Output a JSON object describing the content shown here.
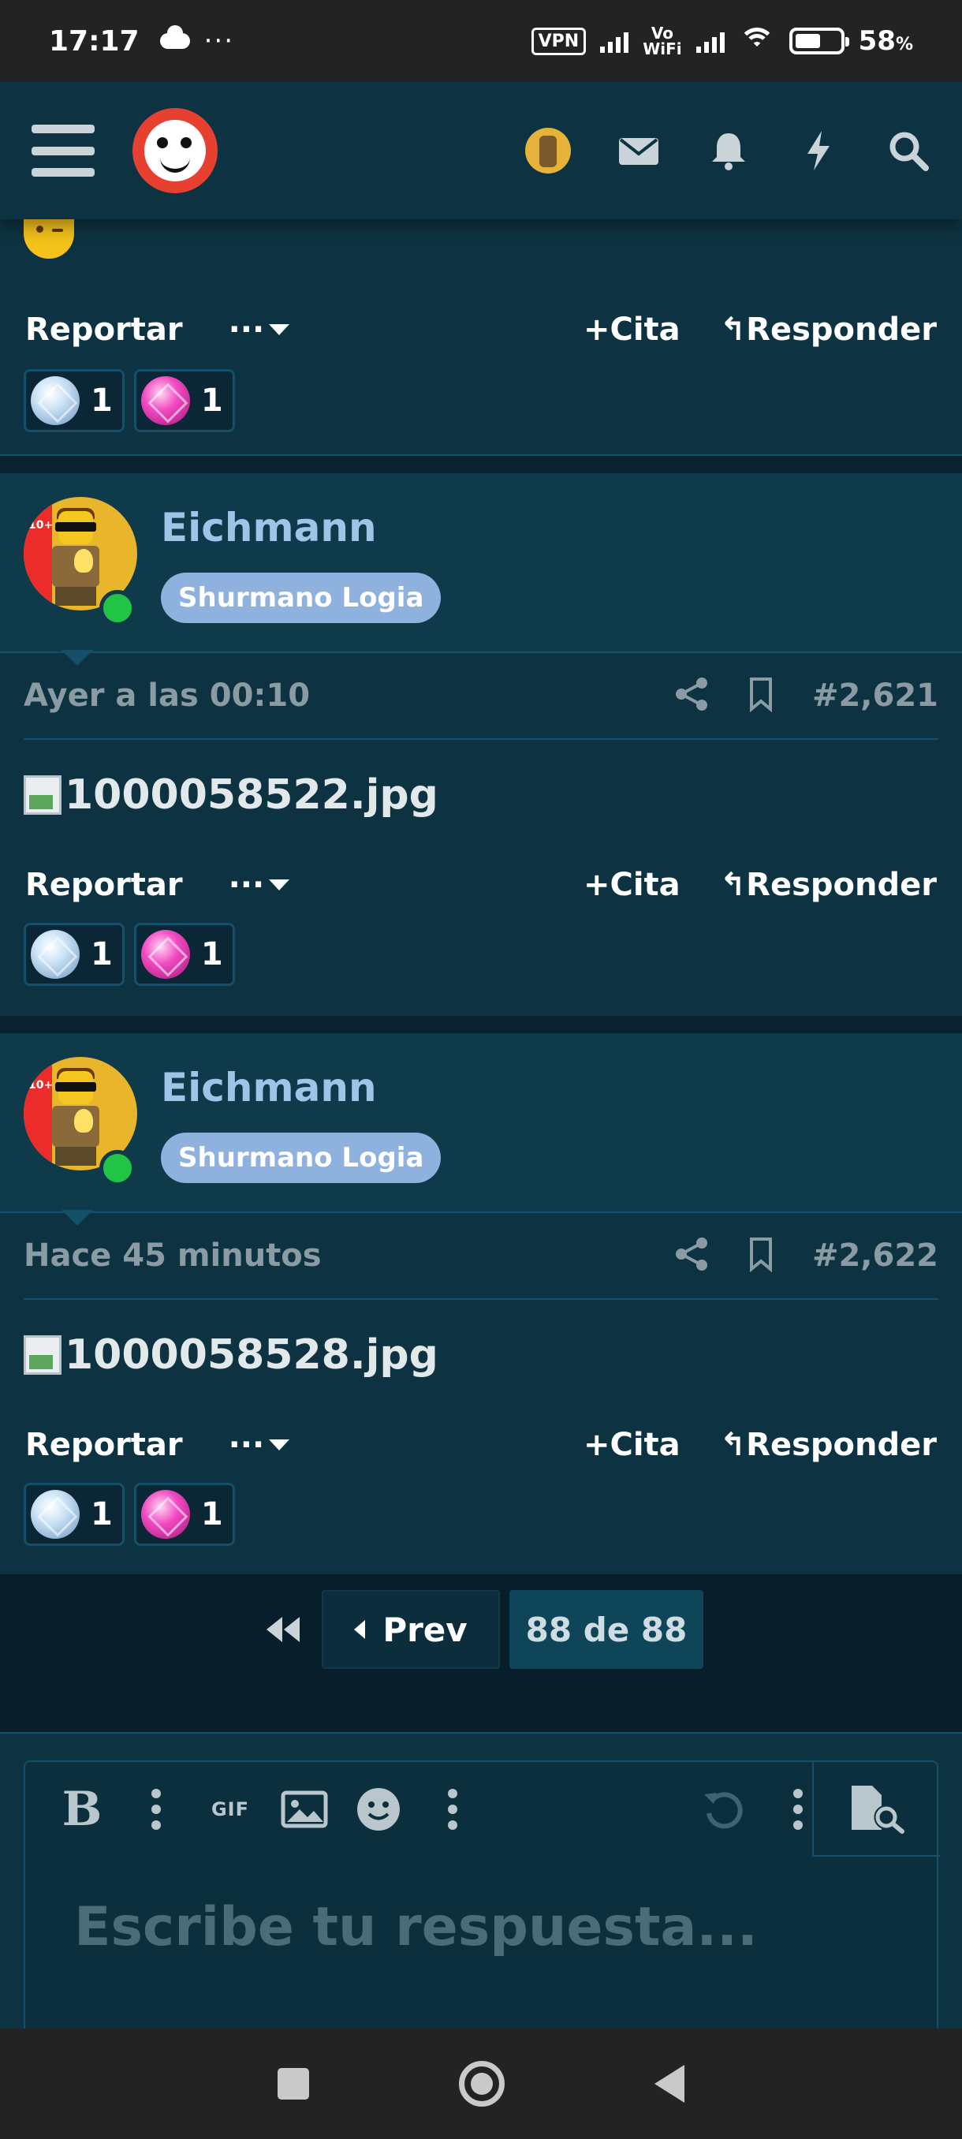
{
  "status_bar": {
    "time": "17:17",
    "dots": "···",
    "vpn": "VPN",
    "vowifi_top": "Vo",
    "vowifi_bottom": "WiFi",
    "battery_value": "58",
    "battery_unit": "%",
    "battery_level": 0.58
  },
  "header": {
    "menu_icon": "hamburger-icon",
    "icons": [
      "avatar",
      "envelope-icon",
      "bell-icon",
      "lightning-icon",
      "search-icon"
    ]
  },
  "colors": {
    "background": "#0c2a3a",
    "card": "#0d3342",
    "username": "#9ec4e8",
    "title_badge": "#8fb1de",
    "online": "#22c445",
    "muted_text": "#8b9ba3"
  },
  "top_post": {
    "actions": {
      "report": "Reportar",
      "more": "···",
      "quote": "Cita",
      "reply": "Responder"
    },
    "reactions": [
      {
        "icon": "blue-gem-icon",
        "count": "1"
      },
      {
        "icon": "pink-gem-icon",
        "count": "1"
      }
    ]
  },
  "posts": [
    {
      "username": "Eichmann",
      "user_title": "Shurmano Logia",
      "date": "Ayer a las 00:10",
      "post_number": "#2,621",
      "image_filename": "1000058522.jpg",
      "actions": {
        "report": "Reportar",
        "more": "···",
        "quote": "Cita",
        "reply": "Responder"
      },
      "reactions": [
        {
          "icon": "blue-gem-icon",
          "count": "1"
        },
        {
          "icon": "pink-gem-icon",
          "count": "1"
        }
      ]
    },
    {
      "username": "Eichmann",
      "user_title": "Shurmano Logia",
      "date": "Hace 45 minutos",
      "post_number": "#2,622",
      "image_filename": "1000058528.jpg",
      "actions": {
        "report": "Reportar",
        "more": "···",
        "quote": "Cita",
        "reply": "Responder"
      },
      "reactions": [
        {
          "icon": "blue-gem-icon",
          "count": "1"
        },
        {
          "icon": "pink-gem-icon",
          "count": "1"
        }
      ]
    }
  ],
  "pagination": {
    "prev_label": "Prev",
    "current": "88 de 88"
  },
  "editor": {
    "bold_label": "B",
    "gif_label": "GIF",
    "placeholder": "Escribe tu respuesta..."
  }
}
